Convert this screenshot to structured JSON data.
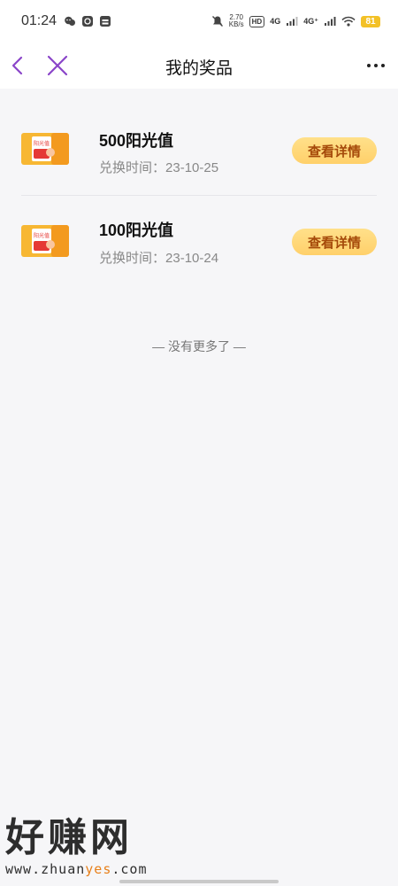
{
  "status_bar": {
    "time": "01:24",
    "left_icons": [
      "wechat-icon",
      "mail-icon",
      "calendar-icon"
    ],
    "speed_value": "2.70",
    "speed_unit": "KB/s",
    "hd_tag": "HD",
    "network_1": "4G",
    "network_2": "4G⁺",
    "battery": "81"
  },
  "nav": {
    "title": "我的奖品",
    "accent_color": "#8a45c9"
  },
  "prizes": [
    {
      "name": "500阳光值",
      "date_label": "兑换时间：",
      "date": "23-10-25",
      "button": "查看详情",
      "thumb_text": "阳光值"
    },
    {
      "name": "100阳光值",
      "date_label": "兑换时间：",
      "date": "23-10-24",
      "button": "查看详情",
      "thumb_text": "阳光值"
    }
  ],
  "footer_note": "— 没有更多了 —",
  "watermark": {
    "cn": "好赚网",
    "url_prefix": "www.zhuan",
    "url_accent": "yes",
    "url_suffix": ".com"
  }
}
